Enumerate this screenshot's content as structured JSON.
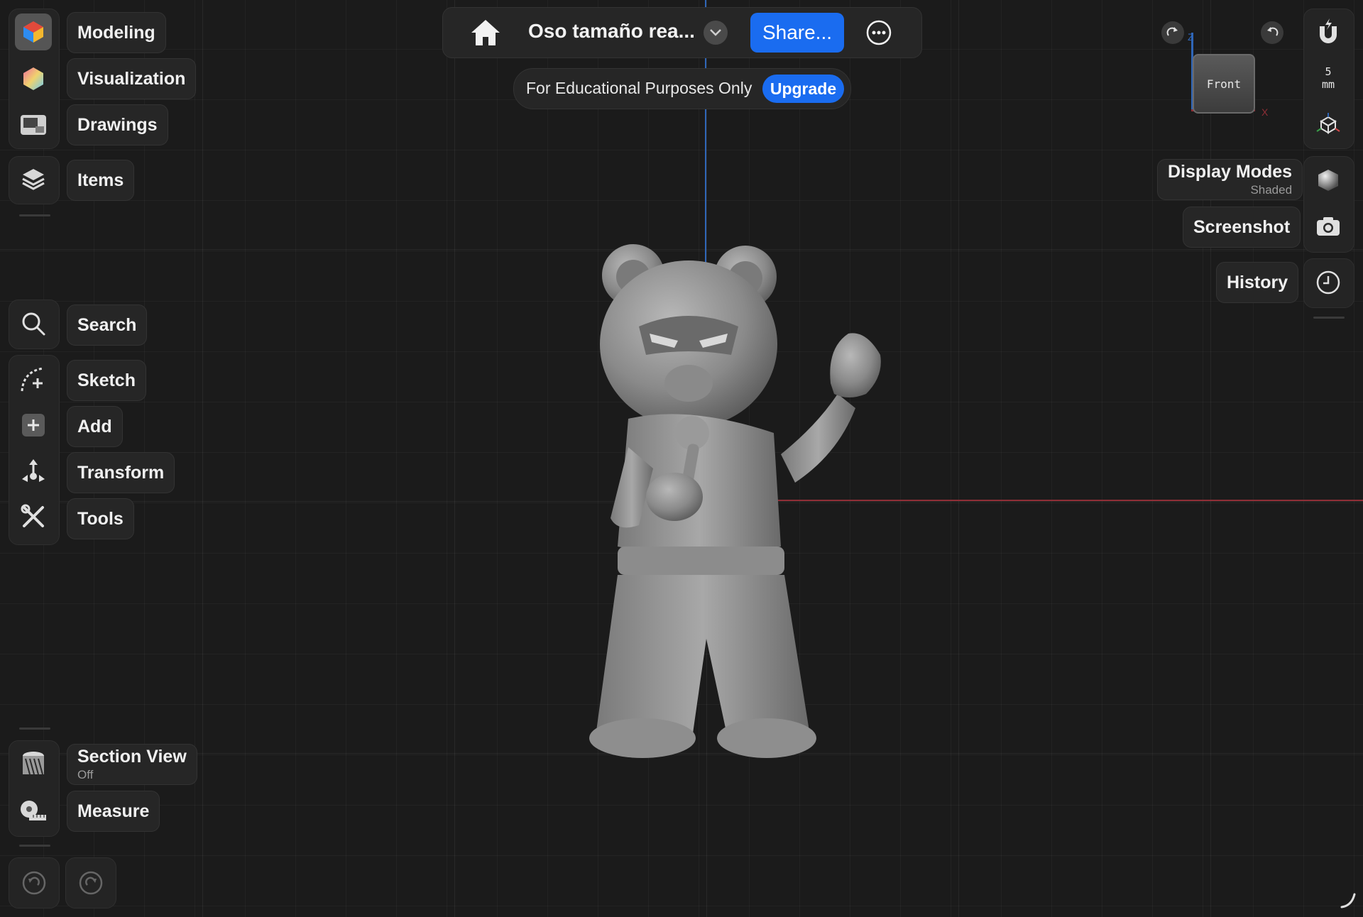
{
  "left_toolbar": {
    "workspaces": [
      {
        "id": "modeling",
        "label": "Modeling",
        "icon": "modeling-cube-icon"
      },
      {
        "id": "visualization",
        "label": "Visualization",
        "icon": "visualization-hexagon-icon"
      },
      {
        "id": "drawings",
        "label": "Drawings",
        "icon": "drawings-sheet-icon"
      }
    ],
    "items": {
      "label": "Items",
      "icon": "layers-icon"
    },
    "tools": [
      {
        "id": "search",
        "label": "Search",
        "icon": "search-icon"
      },
      {
        "id": "sketch",
        "label": "Sketch",
        "icon": "sketch-arc-icon"
      },
      {
        "id": "add",
        "label": "Add",
        "icon": "add-plus-icon"
      },
      {
        "id": "transform",
        "label": "Transform",
        "icon": "transform-arrows-icon"
      },
      {
        "id": "tools",
        "label": "Tools",
        "icon": "tools-wrench-icon"
      }
    ],
    "section_view": {
      "label": "Section View",
      "status": "Off",
      "icon": "section-view-icon"
    },
    "measure": {
      "label": "Measure",
      "icon": "tape-measure-icon"
    },
    "undo_icon": "undo-icon",
    "redo_icon": "redo-icon"
  },
  "top_bar": {
    "home_icon": "home-icon",
    "document_title": "Oso tamaño rea...",
    "title_menu_icon": "chevron-down-icon",
    "share_label": "Share...",
    "more_icon": "more-ellipsis-icon",
    "notice": "For Educational Purposes Only",
    "upgrade_label": "Upgrade"
  },
  "view_cube": {
    "face_label": "Front",
    "axis_z": "Z",
    "axis_x": "X",
    "rotate_cw_icon": "rotate-clockwise-icon",
    "rotate_ccw_icon": "rotate-counterclockwise-icon"
  },
  "right_toolbar": {
    "snap_icon": "magnet-snap-icon",
    "snap_value": "5",
    "snap_unit": "mm",
    "axes_icon": "axes-gizmo-icon",
    "display_modes": {
      "label": "Display Modes",
      "value": "Shaded",
      "icon": "shaded-sphere-icon"
    },
    "screenshot": {
      "label": "Screenshot",
      "icon": "camera-icon"
    },
    "history": {
      "label": "History",
      "icon": "clock-icon"
    }
  },
  "viewport": {
    "model_name": "bear-figure-model",
    "colors": {
      "background": "#1b1b1b",
      "axis_vertical": "#2f66b8",
      "axis_horizontal": "#8e2e36",
      "accent": "#1a6cf0"
    }
  }
}
